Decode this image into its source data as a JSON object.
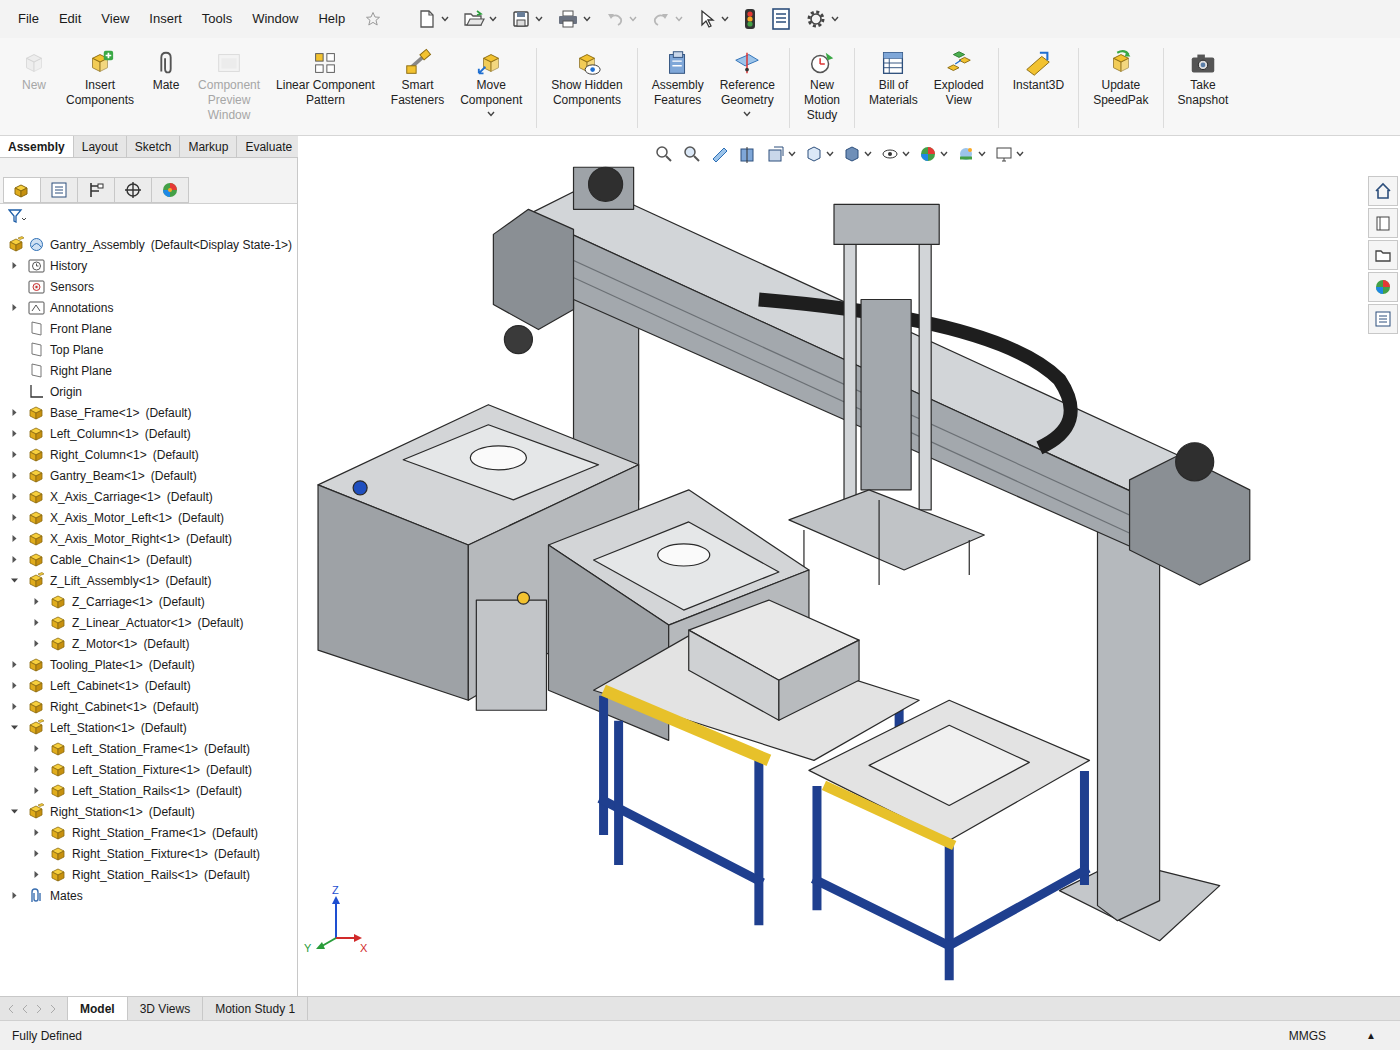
{
  "window": {
    "title": "Gantry_Assembly"
  },
  "menu": [
    "File",
    "Edit",
    "View",
    "Insert",
    "Tools",
    "Window",
    "Help"
  ],
  "quick_access": [
    {
      "dropdown": true,
      "disabled": false
    },
    {
      "dropdown": true,
      "disabled": false
    },
    {
      "dropdown": true,
      "disabled": false
    },
    {
      "dropdown": true,
      "disabled": false
    },
    {
      "dropdown": true,
      "disabled": true
    },
    {
      "dropdown": true,
      "disabled": true
    },
    {
      "dropdown": true,
      "disabled": false
    },
    {
      "dropdown": false,
      "disabled": false
    },
    {
      "dropdown": false,
      "disabled": false
    },
    {
      "dropdown": true,
      "disabled": false
    }
  ],
  "ribbon": {
    "groups": [
      [
        {
          "lines": [
            "New"
          ],
          "disabled": true,
          "dropdown": false
        },
        {
          "lines": [
            "Insert",
            "Components"
          ],
          "disabled": false,
          "dropdown": false
        },
        {
          "lines": [
            "Mate"
          ],
          "disabled": false,
          "dropdown": false
        },
        {
          "lines": [
            "Component",
            "Preview",
            "Window"
          ],
          "disabled": true,
          "dropdown": false
        },
        {
          "lines": [
            "Linear Component",
            "Pattern"
          ],
          "disabled": false,
          "dropdown": false
        },
        {
          "lines": [
            "Smart",
            "Fasteners"
          ],
          "disabled": false,
          "dropdown": false
        },
        {
          "lines": [
            "Move",
            "Component"
          ],
          "disabled": false,
          "dropdown": true
        }
      ],
      [
        {
          "lines": [
            "Show Hidden",
            "Components"
          ],
          "disabled": false,
          "dropdown": false
        }
      ],
      [
        {
          "lines": [
            "Assembly",
            "Features"
          ],
          "disabled": false,
          "dropdown": false
        },
        {
          "lines": [
            "Reference",
            "Geometry"
          ],
          "disabled": false,
          "dropdown": true
        }
      ],
      [
        {
          "lines": [
            "New",
            "Motion",
            "Study"
          ],
          "disabled": false,
          "dropdown": false
        }
      ],
      [
        {
          "lines": [
            "Bill of",
            "Materials"
          ],
          "disabled": false,
          "dropdown": false
        },
        {
          "lines": [
            "Exploded",
            "View"
          ],
          "disabled": false,
          "dropdown": false
        }
      ],
      [
        {
          "lines": [
            "Instant3D"
          ],
          "disabled": false,
          "dropdown": false
        }
      ],
      [
        {
          "lines": [
            "Update",
            "SpeedPak"
          ],
          "disabled": false,
          "dropdown": false
        }
      ],
      [
        {
          "lines": [
            "Take",
            "Snapshot"
          ],
          "disabled": false,
          "dropdown": false
        }
      ]
    ]
  },
  "command_tabs": [
    {
      "label": "Assembly",
      "selected": true
    },
    {
      "label": "Layout",
      "selected": false
    },
    {
      "label": "Sketch",
      "selected": false
    },
    {
      "label": "Markup",
      "selected": false
    },
    {
      "label": "Evaluate",
      "selected": false
    }
  ],
  "panel_tabs": [
    {
      "selected": true
    },
    {
      "selected": false
    },
    {
      "selected": false
    },
    {
      "selected": false
    },
    {
      "selected": false
    }
  ],
  "tree": [
    {
      "name": "Gantry_Assembly",
      "config": "(Default<Display State-1>)",
      "level": 0,
      "kind": "root",
      "expandable": false,
      "expanded": false
    },
    {
      "name": "History",
      "config": "",
      "level": 0,
      "kind": "history",
      "expandable": true,
      "expanded": false
    },
    {
      "name": "Sensors",
      "config": "",
      "level": 0,
      "kind": "sensors",
      "expandable": false,
      "expanded": false
    },
    {
      "name": "Annotations",
      "config": "",
      "level": 0,
      "kind": "annotations",
      "expandable": true,
      "expanded": false
    },
    {
      "name": "Front Plane",
      "config": "",
      "level": 0,
      "kind": "plane",
      "expandable": false,
      "expanded": false
    },
    {
      "name": "Top Plane",
      "config": "",
      "level": 0,
      "kind": "plane",
      "expandable": false,
      "expanded": false
    },
    {
      "name": "Right Plane",
      "config": "",
      "level": 0,
      "kind": "plane",
      "expandable": false,
      "expanded": false
    },
    {
      "name": "Origin",
      "config": "",
      "level": 0,
      "kind": "origin",
      "expandable": false,
      "expanded": false
    },
    {
      "name": "Base_Frame<1>",
      "config": "(Default)",
      "level": 0,
      "kind": "part",
      "expandable": true,
      "expanded": false
    },
    {
      "name": "Left_Column<1>",
      "config": "(Default)",
      "level": 0,
      "kind": "part",
      "expandable": true,
      "expanded": false
    },
    {
      "name": "Right_Column<1>",
      "config": "(Default)",
      "level": 0,
      "kind": "part",
      "expandable": true,
      "expanded": false
    },
    {
      "name": "Gantry_Beam<1>",
      "config": "(Default)",
      "level": 0,
      "kind": "part",
      "expandable": true,
      "expanded": false
    },
    {
      "name": "X_Axis_Carriage<1>",
      "config": "(Default)",
      "level": 0,
      "kind": "part",
      "expandable": true,
      "expanded": false
    },
    {
      "name": "X_Axis_Motor_Left<1>",
      "config": "(Default)",
      "level": 0,
      "kind": "part",
      "expandable": true,
      "expanded": false
    },
    {
      "name": "X_Axis_Motor_Right<1>",
      "config": "(Default)",
      "level": 0,
      "kind": "part",
      "expandable": true,
      "expanded": false
    },
    {
      "name": "Cable_Chain<1>",
      "config": "(Default)",
      "level": 0,
      "kind": "part",
      "expandable": true,
      "expanded": false
    },
    {
      "name": "Z_Lift_Assembly<1>",
      "config": "(Default)",
      "level": 0,
      "kind": "assembly",
      "expandable": true,
      "expanded": true
    },
    {
      "name": "Z_Carriage<1>",
      "config": "(Default)",
      "level": 1,
      "kind": "part",
      "expandable": true,
      "expanded": false
    },
    {
      "name": "Z_Linear_Actuator<1>",
      "config": "(Default)",
      "level": 1,
      "kind": "part",
      "expandable": true,
      "expanded": false
    },
    {
      "name": "Z_Motor<1>",
      "config": "(Default)",
      "level": 1,
      "kind": "part",
      "expandable": true,
      "expanded": false
    },
    {
      "name": "Tooling_Plate<1>",
      "config": "(Default)",
      "level": 0,
      "kind": "part",
      "expandable": true,
      "expanded": false
    },
    {
      "name": "Left_Cabinet<1>",
      "config": "(Default)",
      "level": 0,
      "kind": "part",
      "expandable": true,
      "expanded": false
    },
    {
      "name": "Right_Cabinet<1>",
      "config": "(Default)",
      "level": 0,
      "kind": "part",
      "expandable": true,
      "expanded": false
    },
    {
      "name": "Left_Station<1>",
      "config": "(Default)",
      "level": 0,
      "kind": "assembly",
      "expandable": true,
      "expanded": true
    },
    {
      "name": "Left_Station_Frame<1>",
      "config": "(Default)",
      "level": 1,
      "kind": "part",
      "expandable": true,
      "expanded": false
    },
    {
      "name": "Left_Station_Fixture<1>",
      "config": "(Default)",
      "level": 1,
      "kind": "part",
      "expandable": true,
      "expanded": false
    },
    {
      "name": "Left_Station_Rails<1>",
      "config": "(Default)",
      "level": 1,
      "kind": "part",
      "expandable": true,
      "expanded": false
    },
    {
      "name": "Right_Station<1>",
      "config": "(Default)",
      "level": 0,
      "kind": "assembly",
      "expandable": true,
      "expanded": true
    },
    {
      "name": "Right_Station_Frame<1>",
      "config": "(Default)",
      "level": 1,
      "kind": "part",
      "expandable": true,
      "expanded": false
    },
    {
      "name": "Right_Station_Fixture<1>",
      "config": "(Default)",
      "level": 1,
      "kind": "part",
      "expandable": true,
      "expanded": false
    },
    {
      "name": "Right_Station_Rails<1>",
      "config": "(Default)",
      "level": 1,
      "kind": "part",
      "expandable": true,
      "expanded": false
    },
    {
      "name": "Mates",
      "config": "",
      "level": 0,
      "kind": "mates",
      "expandable": true,
      "expanded": false
    }
  ],
  "bottom_tabs": [
    {
      "label": "Model",
      "selected": true
    },
    {
      "label": "3D Views",
      "selected": false
    },
    {
      "label": "Motion Study 1",
      "selected": false
    }
  ],
  "triad": {
    "x": "X",
    "y": "Y",
    "z": "Z"
  },
  "status_bar": {
    "left": "Fully Defined",
    "units": "MMGS",
    "caret": "▲"
  }
}
